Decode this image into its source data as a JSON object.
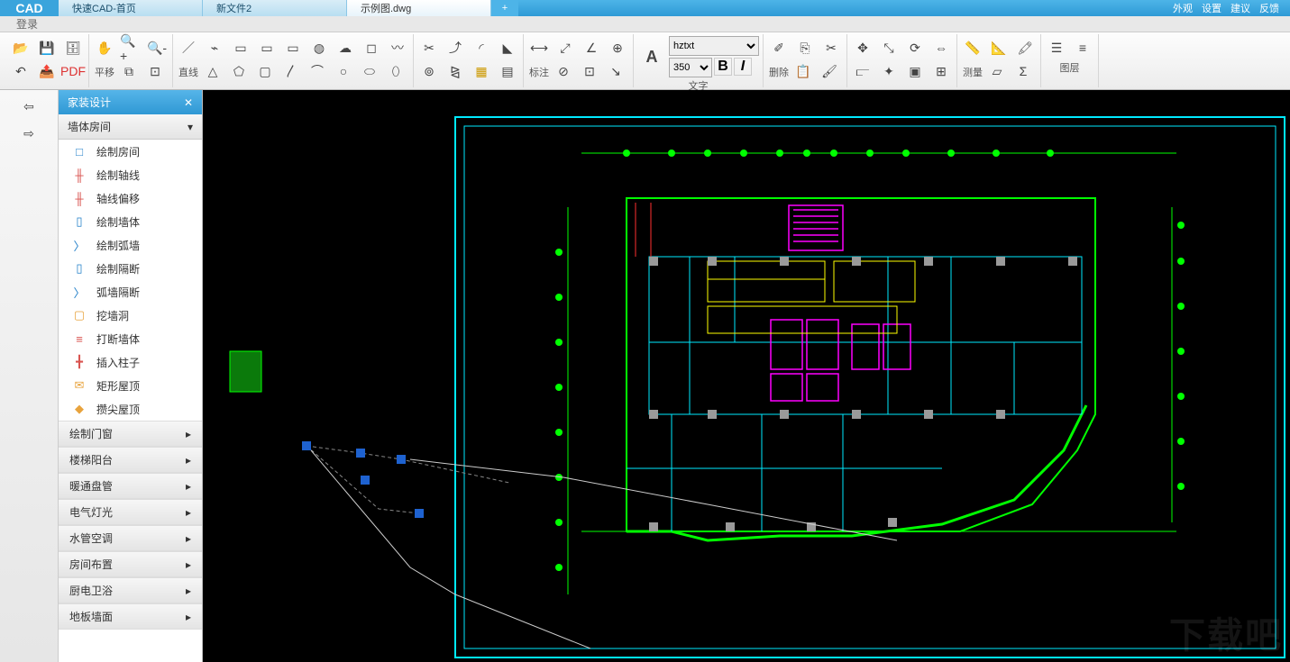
{
  "app": {
    "login": "登录",
    "logo": "CAD"
  },
  "tabs": [
    {
      "label": "快速CAD-首页",
      "active": false
    },
    {
      "label": "新文件2",
      "active": false
    },
    {
      "label": "示例图.dwg",
      "active": true
    }
  ],
  "top_right": [
    "外观",
    "设置",
    "建议",
    "反馈"
  ],
  "ribbon": {
    "pan": "平移",
    "line": "直线",
    "annotate": "标注",
    "text": "文字",
    "delete": "删除",
    "measure": "测量",
    "layer": "图层",
    "font_options": [
      "hztxt"
    ],
    "font_selected": "hztxt",
    "size_options": [
      "350"
    ],
    "size_selected": "350",
    "bold": "B",
    "italic": "I"
  },
  "sidepanel": {
    "title": "家装设计",
    "section": "墙体房间",
    "items": [
      {
        "icon": "□",
        "color": "#1e7dc8",
        "label": "绘制房间"
      },
      {
        "icon": "╫",
        "color": "#d9534f",
        "label": "绘制轴线"
      },
      {
        "icon": "╫",
        "color": "#d9534f",
        "label": "轴线偏移"
      },
      {
        "icon": "▯",
        "color": "#1e7dc8",
        "label": "绘制墙体"
      },
      {
        "icon": "〉",
        "color": "#1e7dc8",
        "label": "绘制弧墙"
      },
      {
        "icon": "▯",
        "color": "#1e7dc8",
        "label": "绘制隔断"
      },
      {
        "icon": "〉",
        "color": "#1e7dc8",
        "label": "弧墙隔断"
      },
      {
        "icon": "▢",
        "color": "#e8a33d",
        "label": "挖墙洞"
      },
      {
        "icon": "≡",
        "color": "#d9534f",
        "label": "打断墙体"
      },
      {
        "icon": "╋",
        "color": "#d9534f",
        "label": "插入柱子"
      },
      {
        "icon": "✉",
        "color": "#e8a33d",
        "label": "矩形屋顶"
      },
      {
        "icon": "◆",
        "color": "#e8a33d",
        "label": "攒尖屋顶"
      }
    ],
    "categories": [
      "绘制门窗",
      "楼梯阳台",
      "暖通盘管",
      "电气灯光",
      "水管空调",
      "房间布置",
      "厨电卫浴",
      "地板墙面"
    ]
  },
  "watermark": "下载吧"
}
